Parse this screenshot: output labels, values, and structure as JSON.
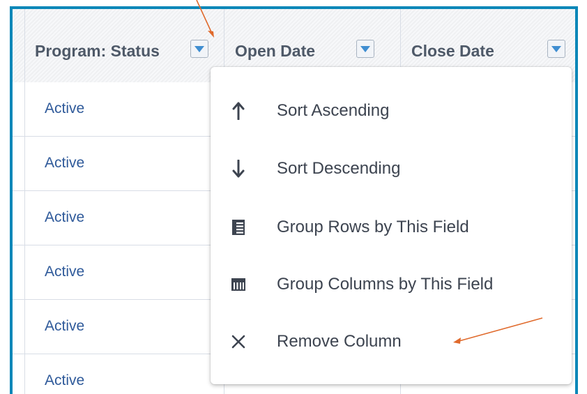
{
  "table": {
    "columns": [
      {
        "label": "Program: Status"
      },
      {
        "label": "Open Date"
      },
      {
        "label": "Close Date"
      }
    ],
    "rows": [
      {
        "status": "Active"
      },
      {
        "status": "Active"
      },
      {
        "status": "Active"
      },
      {
        "status": "Active"
      },
      {
        "status": "Active"
      },
      {
        "status": "Active"
      }
    ]
  },
  "menu": {
    "items": [
      {
        "label": "Sort Ascending",
        "icon": "arrow-up-icon"
      },
      {
        "label": "Sort Descending",
        "icon": "arrow-down-icon"
      },
      {
        "label": "Group Rows by This Field",
        "icon": "group-rows-icon"
      },
      {
        "label": "Group Columns by This Field",
        "icon": "group-columns-icon"
      },
      {
        "label": "Remove Column",
        "icon": "close-icon"
      }
    ]
  },
  "colors": {
    "frame_border": "#0a87b8",
    "link_text": "#2f5a9a",
    "annotation_arrow": "#e06a2c"
  }
}
